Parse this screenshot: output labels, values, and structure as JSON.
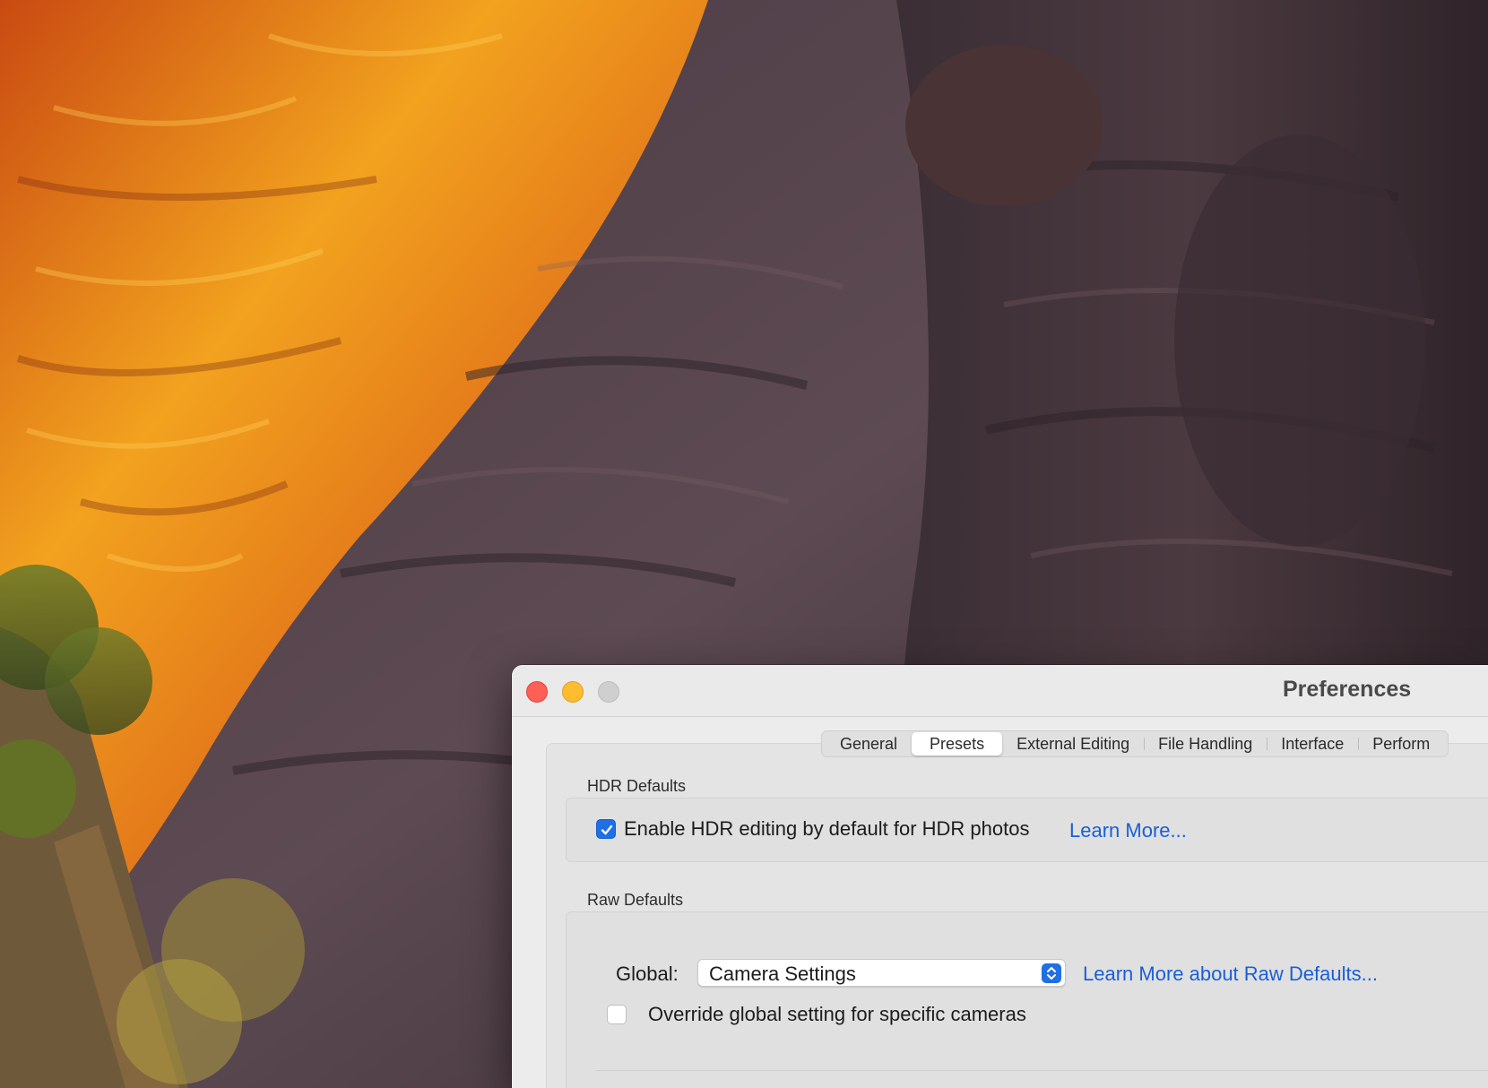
{
  "window": {
    "title": "Preferences"
  },
  "tabs": [
    {
      "label": "General"
    },
    {
      "label": "Presets",
      "active": true
    },
    {
      "label": "External Editing"
    },
    {
      "label": "File Handling"
    },
    {
      "label": "Interface"
    },
    {
      "label": "Perform"
    }
  ],
  "hdr_defaults": {
    "section_label": "HDR Defaults",
    "enable_hdr_label": "Enable HDR editing by default for HDR photos",
    "enable_hdr_checked": true,
    "learn_more_link": "Learn More..."
  },
  "raw_defaults": {
    "section_label": "Raw Defaults",
    "global_label": "Global:",
    "global_value": "Camera Settings",
    "learn_more_link": "Learn More about Raw Defaults...",
    "override_label": "Override global setting for specific cameras",
    "override_checked": false
  },
  "colors": {
    "accent": "#1f6fe5",
    "link": "#1a5fd6",
    "close": "#fe5f57",
    "minimize": "#febc2e",
    "zoom": "#cfcfcf"
  },
  "icons": [
    "close-button",
    "minimize-button",
    "zoom-button",
    "checkmark-icon",
    "chevron-updown-icon"
  ]
}
